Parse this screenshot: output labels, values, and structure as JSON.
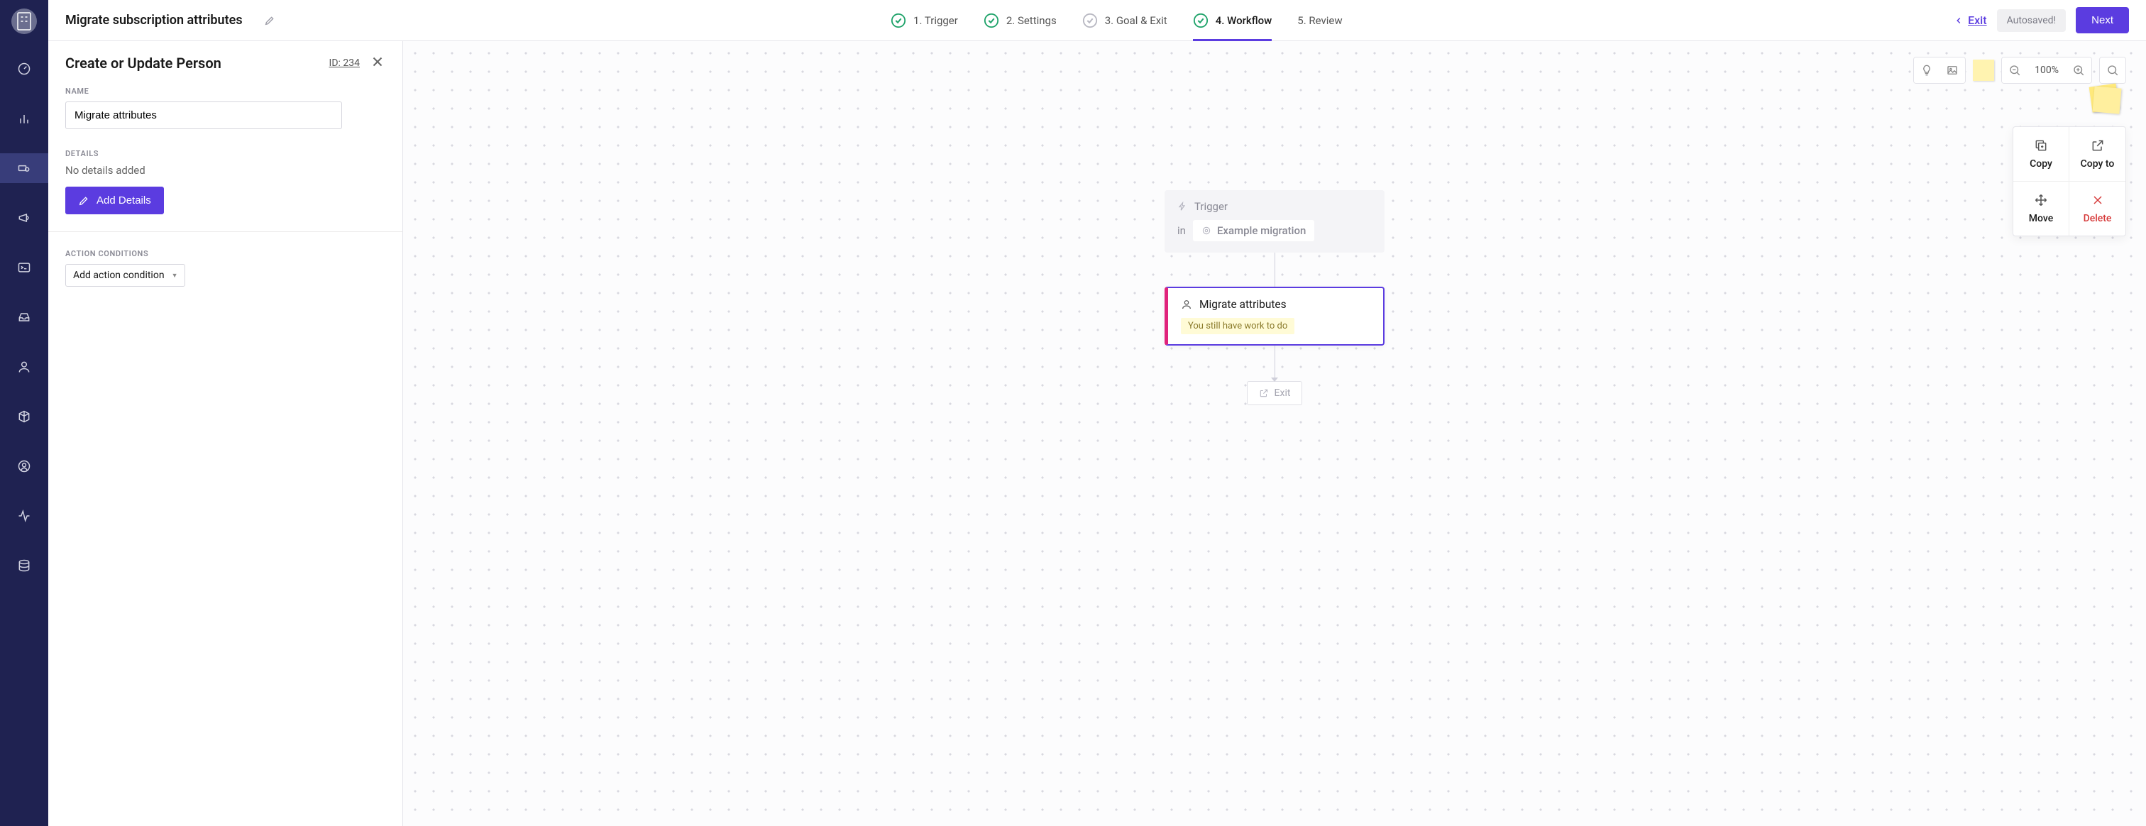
{
  "page_title": "Migrate subscription attributes",
  "steps": [
    {
      "label": "1. Trigger",
      "state": "done"
    },
    {
      "label": "2. Settings",
      "state": "done"
    },
    {
      "label": "3. Goal & Exit",
      "state": "pending"
    },
    {
      "label": "4. Workflow",
      "state": "done",
      "active": true
    },
    {
      "label": "5. Review",
      "state": "none"
    }
  ],
  "topbar": {
    "exit": "Exit",
    "autosaved": "Autosaved!",
    "next": "Next"
  },
  "panel": {
    "title": "Create or Update Person",
    "id_label": "ID: 234",
    "name_label": "NAME",
    "name_value": "Migrate attributes",
    "details_label": "DETAILS",
    "details_empty": "No details added",
    "add_details": "Add Details",
    "action_conditions_label": "ACTION CONDITIONS",
    "add_condition": "Add action condition"
  },
  "canvas": {
    "zoom": "100%",
    "trigger_label": "Trigger",
    "segment_in": "in",
    "segment_name": "Example migration",
    "action_name": "Migrate attributes",
    "work_msg": "You still have work to do",
    "exit_label": "Exit"
  },
  "node_actions": {
    "copy": "Copy",
    "copy_to": "Copy to",
    "move": "Move",
    "delete": "Delete"
  }
}
